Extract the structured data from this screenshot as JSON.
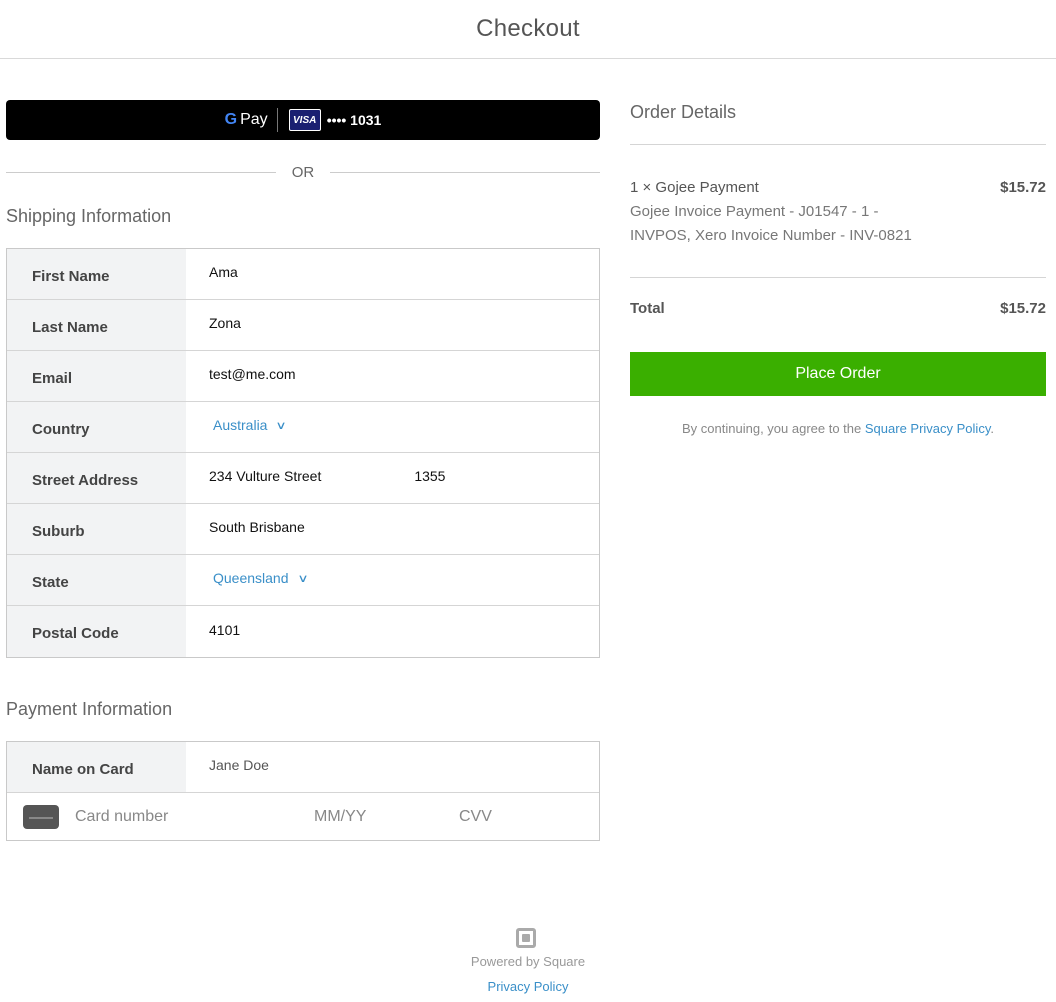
{
  "header": {
    "title": "Checkout"
  },
  "gpay": {
    "g": "G",
    "pay": "Pay",
    "card_brand": "VISA",
    "card_last4": "•••• 1031"
  },
  "divider_text": "OR",
  "shipping": {
    "title": "Shipping Information",
    "fields": {
      "first_name": {
        "label": "First Name",
        "value": "Ama"
      },
      "last_name": {
        "label": "Last Name",
        "value": "Zona"
      },
      "email": {
        "label": "Email",
        "value": "test@me.com"
      },
      "country": {
        "label": "Country",
        "value": "Australia"
      },
      "street": {
        "label": "Street Address",
        "value": "234 Vulture Street",
        "extra": "1355"
      },
      "suburb": {
        "label": "Suburb",
        "value": "South Brisbane"
      },
      "state": {
        "label": "State",
        "value": "Queensland"
      },
      "postal": {
        "label": "Postal Code",
        "value": "4101"
      }
    }
  },
  "payment": {
    "title": "Payment Information",
    "name_on_card": {
      "label": "Name on Card",
      "placeholder": "Jane Doe"
    },
    "card_number_placeholder": "Card number",
    "expiry_placeholder": "MM/YY",
    "cvv_placeholder": "CVV"
  },
  "order": {
    "title": "Order Details",
    "item": {
      "name": "1 × Gojee Payment",
      "description": "Gojee Invoice Payment - J01547 - 1 - INVPOS, Xero Invoice Number - INV-0821",
      "price": "$15.72"
    },
    "total_label": "Total",
    "total_value": "$15.72",
    "place_order": "Place Order",
    "agree_text": "By continuing, you agree to the",
    "agree_link": "Square Privacy Policy",
    "agree_end": "."
  },
  "footer": {
    "powered": "Powered by Square",
    "privacy": "Privacy Policy"
  },
  "colors": {
    "accent": "#3aaf00",
    "link": "#3a8fc8"
  },
  "icons": {
    "chevron": "chevron-down-icon",
    "card": "credit-card-icon",
    "square": "square-logo-icon"
  }
}
